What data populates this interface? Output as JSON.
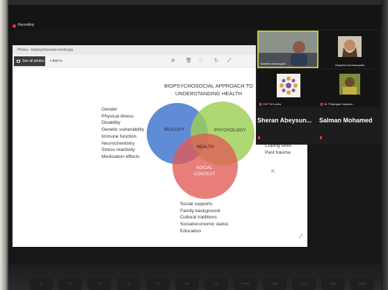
{
  "meeting": {
    "recording_label": "Recording"
  },
  "viewer": {
    "title": "Photos - biopsychosocial+model.jpg",
    "see_all_photos": "See all photos",
    "add_to": "+ Add to",
    "tools": [
      "⊕",
      "🗑",
      "♡",
      "↻",
      "⤢"
    ],
    "expand_glyph": "⤢"
  },
  "slide": {
    "heading_line1": "BIOPSYCHOSOCIAL APPROACH TO",
    "heading_line2": "UNDERSTANDING HEALTH",
    "circles": {
      "biology": {
        "label": "BIOLOGY",
        "color": "#4f7fd3"
      },
      "psychology": {
        "label": "PSYCHOLOGY",
        "color": "#9ccf55"
      },
      "social_line1": "SOCIAL",
      "social_line2": "CONTEXT",
      "social_color": "#e25a55",
      "health": "HEALTH"
    },
    "biology_factors": [
      "Gender",
      "Physical illness",
      "Disability",
      "Genetic vulnerability",
      "Immune function",
      "Neurochemistry",
      "Stress reactivity",
      "Medication effects"
    ],
    "psychology_factors": [
      "Coping skills",
      "Past trauma"
    ],
    "social_factors": [
      "Social supports",
      "Family background",
      "Cultural traditions",
      "Social/economic status",
      "Education"
    ]
  },
  "participants": {
    "tiles": [
      {
        "name": "Matthew Attanayake",
        "highlighted": true
      },
      {
        "name": "Gayathri Karunanayaka",
        "highlighted": false
      },
      {
        "name": "CKF Sri Lanka",
        "highlighted": false
      },
      {
        "name": "Dr. Priyangani Jayasun...",
        "highlighted": false
      }
    ],
    "large_names": [
      "Sheran Abeysun...",
      "Salman Mohamed"
    ]
  },
  "keyboard": {
    "keys": [
      "F5",
      "F6",
      "F7",
      "F8",
      "F9",
      "F10",
      "F11",
      "PrtScn",
      "Home",
      "End",
      "PgUp",
      "PgDn"
    ]
  }
}
